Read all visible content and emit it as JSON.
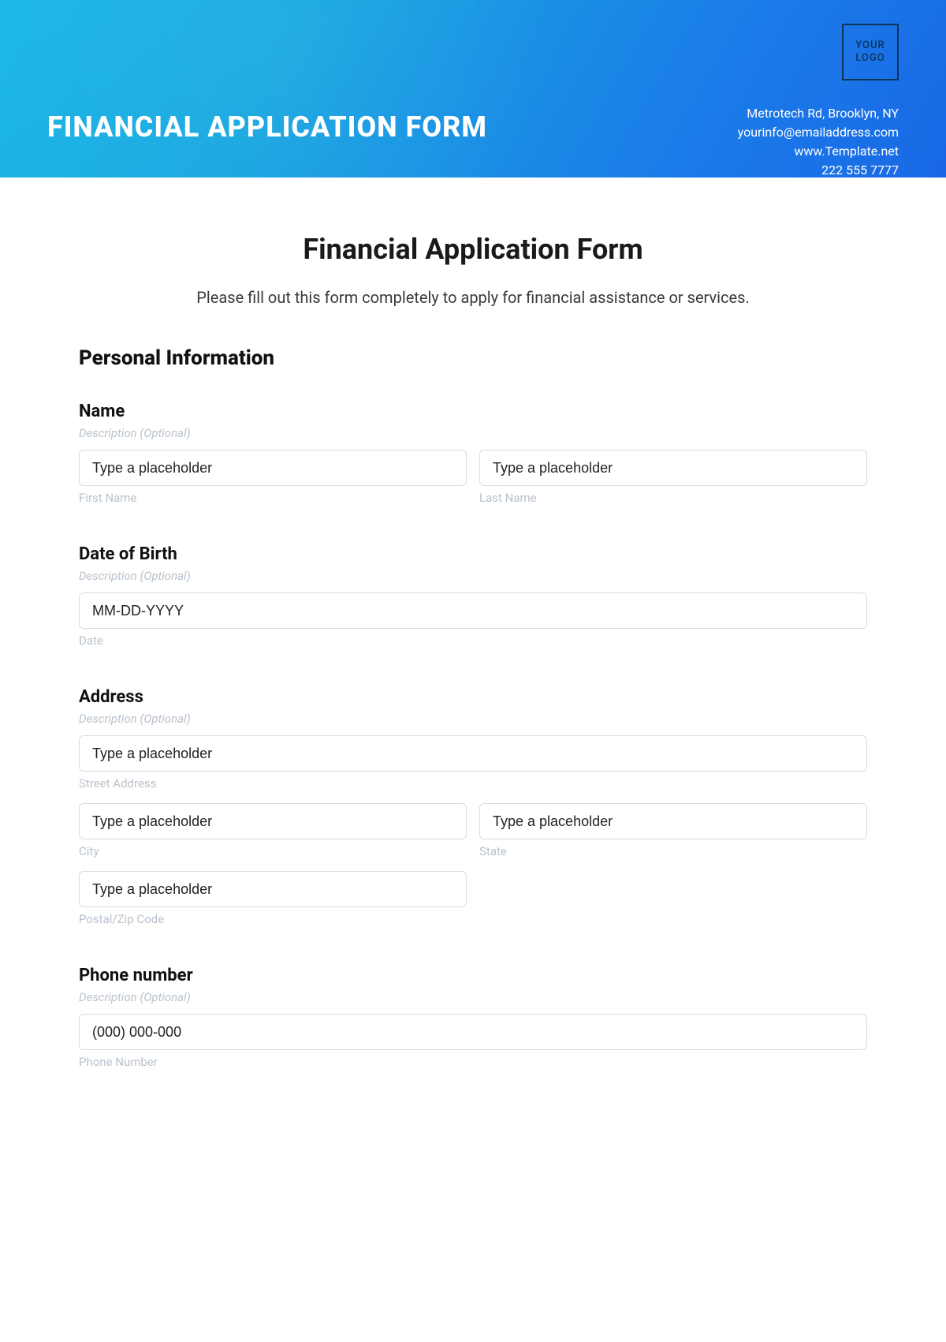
{
  "header": {
    "title": "FINANCIAL APPLICATION FORM",
    "logo_text": "YOUR LOGO",
    "contact": {
      "address": "Metrotech Rd, Brooklyn, NY",
      "email": "yourinfo@emailaddress.com",
      "website": "www.Template.net",
      "phone": "222 555 7777"
    }
  },
  "form": {
    "title": "Financial Application Form",
    "instructions": "Please fill out this form completely to apply for financial assistance or services.",
    "section1": "Personal Information",
    "desc_text": "Description (Optional)",
    "name": {
      "label": "Name",
      "first_placeholder": "Type a placeholder",
      "first_sub": "First Name",
      "last_placeholder": "Type a placeholder",
      "last_sub": "Last Name"
    },
    "dob": {
      "label": "Date of Birth",
      "placeholder": "MM-DD-YYYY",
      "sub": "Date"
    },
    "address": {
      "label": "Address",
      "street_placeholder": "Type a placeholder",
      "street_sub": "Street Address",
      "city_placeholder": "Type a placeholder",
      "city_sub": "City",
      "state_placeholder": "Type a placeholder",
      "state_sub": "State",
      "zip_placeholder": "Type a placeholder",
      "zip_sub": "Postal/Zip Code"
    },
    "phone": {
      "label": "Phone number",
      "placeholder": "(000) 000-000",
      "sub": "Phone Number"
    }
  }
}
